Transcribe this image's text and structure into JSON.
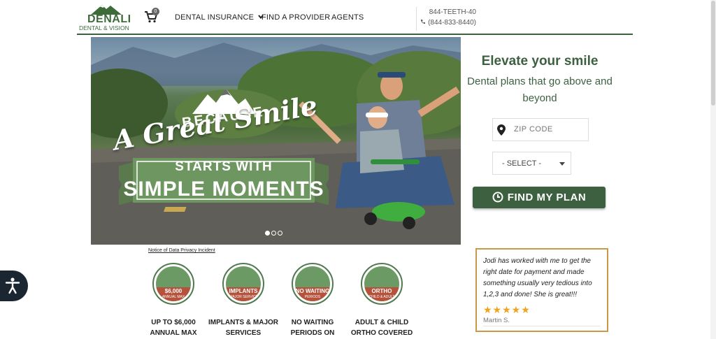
{
  "brand": {
    "name": "DENALI",
    "sub": "DENTAL & VISION",
    "color": "#3d6b3a"
  },
  "cart": {
    "count": "0",
    "icon": "cart-icon"
  },
  "nav": {
    "items": [
      {
        "label": "DENTAL INSURANCE",
        "has_dropdown": true
      },
      {
        "label": "FIND A PROVIDER"
      },
      {
        "label": "AGENTS"
      }
    ]
  },
  "phone": {
    "vanity": "844-TEETH-40",
    "number": "(844-833-8440)"
  },
  "hero": {
    "because": "BECAUSE",
    "headline": "A Great Smile",
    "banner_line1": "STARTS WITH",
    "banner_line2": "SIMPLE MOMENTS",
    "slides": 3,
    "active_slide": 1
  },
  "privacy_link": "Notice of Data Privacy Incident",
  "features": [
    {
      "badge_main": "$6,000",
      "badge_sub": "ANNUAL MAX",
      "label": "UP TO $6,000 ANNUAL MAX"
    },
    {
      "badge_main": "IMPLANTS",
      "badge_sub": "& MAJOR SERVICES",
      "label": "IMPLANTS & MAJOR SERVICES"
    },
    {
      "badge_main": "NO WAITING",
      "badge_sub": "PERIODS",
      "label": "NO WAITING PERIODS ON"
    },
    {
      "badge_main": "ORTHO",
      "badge_sub": "CHILD & ADULT",
      "label": "ADULT & CHILD ORTHO COVERED"
    }
  ],
  "plan_finder": {
    "title": "Elevate your smile",
    "tagline": "Dental plans that go above and beyond",
    "zip_placeholder": "ZIP CODE",
    "select_value": "- SELECT -",
    "button_label": "FIND MY PLAN",
    "accent": "#3d6040"
  },
  "testimonial": {
    "quote": "Jodi has worked with me to get the right date for payment and made something usually very tedious into 1,2,3 and done! She is great!!!",
    "stars": "★★★★★",
    "rating": 5,
    "author": "Martin S.",
    "border_color": "#c79a4a"
  }
}
